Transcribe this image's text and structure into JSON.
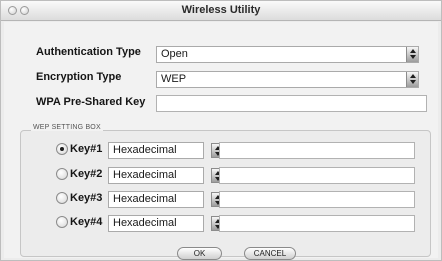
{
  "window": {
    "title": "Wireless Utility"
  },
  "fields": {
    "auth_type": {
      "label": "Authentication Type",
      "value": "Open"
    },
    "enc_type": {
      "label": "Encryption Type",
      "value": "WEP"
    },
    "wpa_key": {
      "label": "WPA Pre-Shared Key",
      "value": ""
    }
  },
  "wep_box": {
    "title": "WEP SETTING BOX",
    "keys": [
      {
        "label": "Key#1",
        "format": "Hexadecimal",
        "value": "",
        "selected": true
      },
      {
        "label": "Key#2",
        "format": "Hexadecimal",
        "value": "",
        "selected": false
      },
      {
        "label": "Key#3",
        "format": "Hexadecimal",
        "value": "",
        "selected": false
      },
      {
        "label": "Key#4",
        "format": "Hexadecimal",
        "value": "",
        "selected": false
      }
    ]
  },
  "buttons": {
    "ok": "OK",
    "cancel": "CANCEL"
  }
}
